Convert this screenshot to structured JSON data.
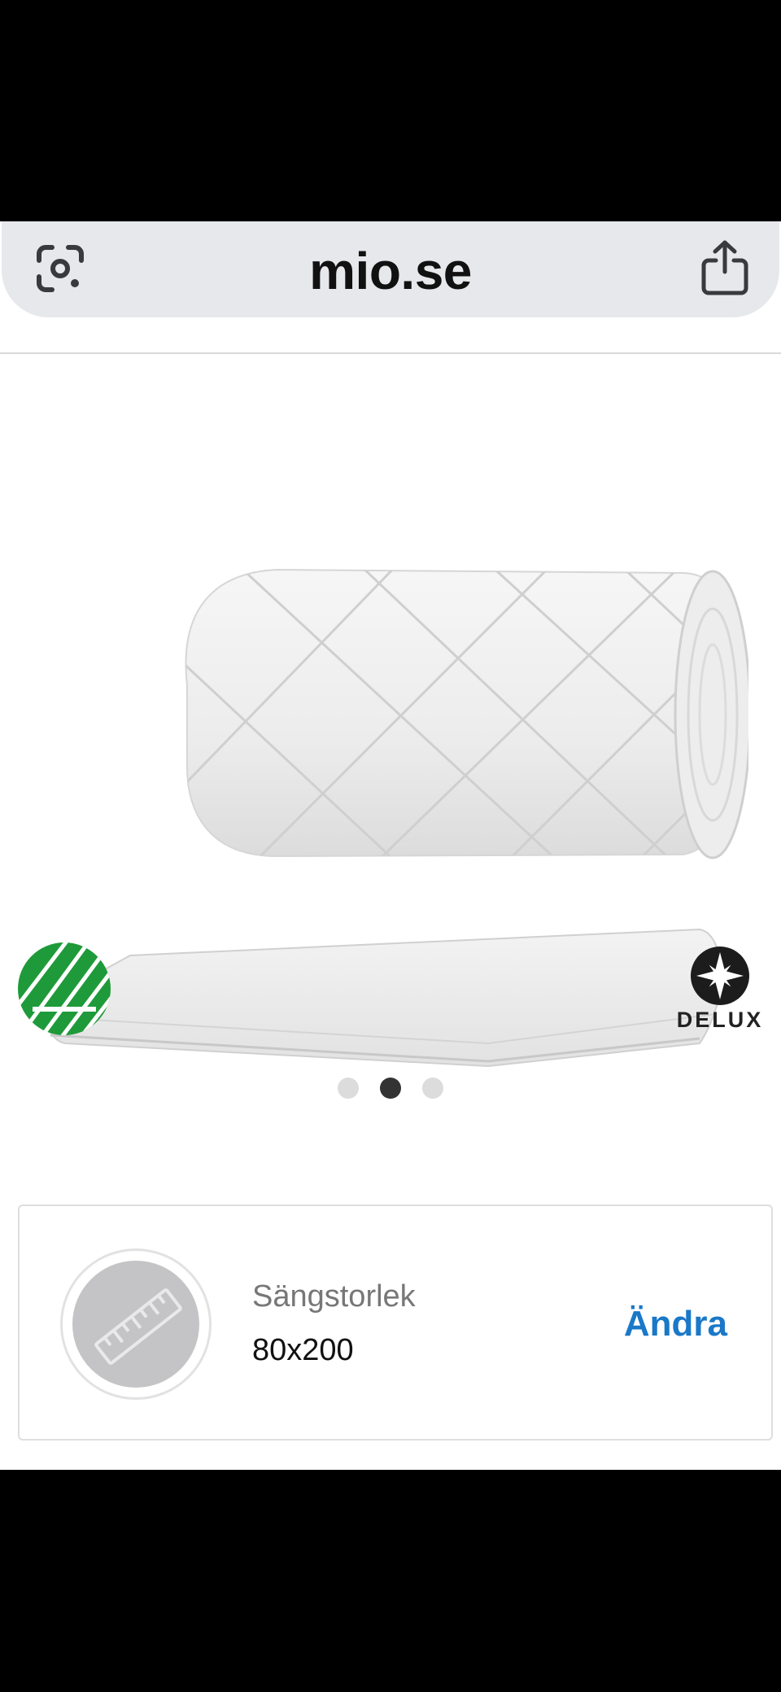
{
  "browser": {
    "domain": "mio.se",
    "icons": {
      "left": "camera-lens-icon",
      "right": "share-icon"
    }
  },
  "product": {
    "image": "rolled-quilted-mattress-topper",
    "badges": {
      "left": "nordic-swan-ecolabel-icon",
      "right_logo_text": "DELUX"
    },
    "carousel": {
      "total": 3,
      "active": 2
    }
  },
  "size_selector": {
    "icon": "ruler-icon",
    "label": "Sängstorlek",
    "value": "80x200",
    "action_label": "Ändra"
  },
  "colors": {
    "link": "#1a78c8",
    "ecolabel_green": "#1f9a3a"
  }
}
